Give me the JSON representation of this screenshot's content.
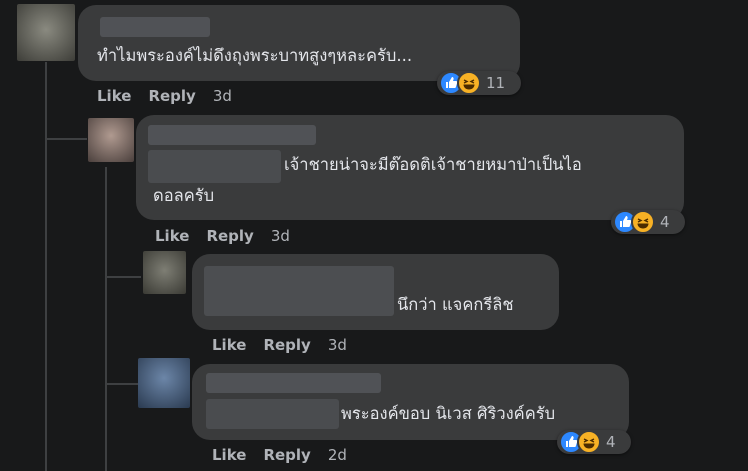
{
  "comments": [
    {
      "text": "ทำไมพระองค์ไม่ดึงถุงพระบาทสูงๆหละครับ...",
      "actions": {
        "like": "Like",
        "reply": "Reply",
        "time": "3d"
      },
      "reactions": {
        "count": "11",
        "types": [
          "like-icon",
          "haha-icon"
        ]
      }
    },
    {
      "text_line1": "เจ้าชายน่าจะมีต๊อดติเจ้าชายหมาป่าเป็นไอ",
      "text_line2": "ดอลครับ",
      "actions": {
        "like": "Like",
        "reply": "Reply",
        "time": "3d"
      },
      "reactions": {
        "count": "4",
        "types": [
          "like-icon",
          "haha-icon"
        ]
      }
    },
    {
      "text": "นึกว่า แจคกรีลิช",
      "actions": {
        "like": "Like",
        "reply": "Reply",
        "time": "3d"
      }
    },
    {
      "text": "พระองค์ขอบ นิเวส ศิริวงค์ครับ",
      "actions": {
        "like": "Like",
        "reply": "Reply",
        "time": "2d"
      },
      "reactions": {
        "count": "4",
        "types": [
          "like-icon",
          "haha-icon"
        ]
      }
    }
  ],
  "colors": {
    "background": "#18191a",
    "bubble": "#3a3b3c",
    "text": "#e4e6eb",
    "meta": "#b0b3b8",
    "like": "#2d88ff",
    "haha": "#f7b125"
  }
}
